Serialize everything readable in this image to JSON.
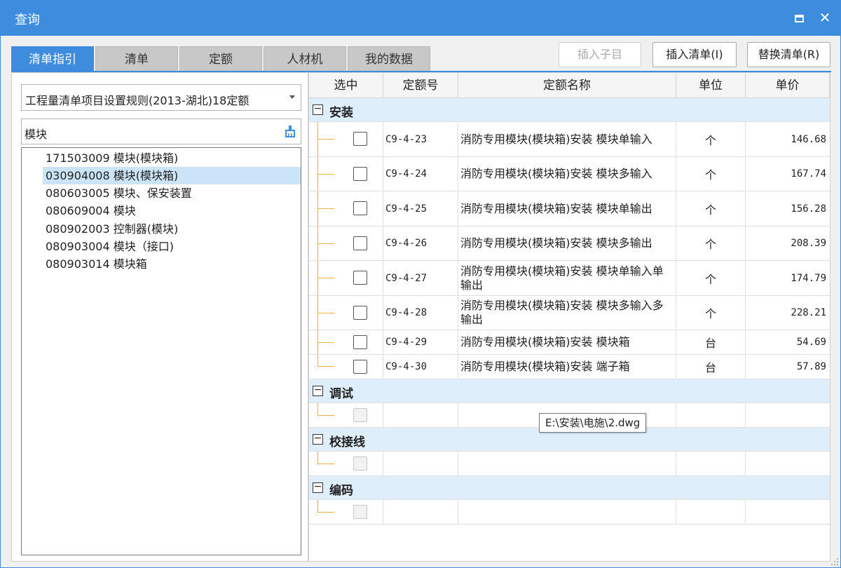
{
  "window": {
    "title": "查询"
  },
  "tabs": [
    {
      "label": "清单指引"
    },
    {
      "label": "清单"
    },
    {
      "label": "定额"
    },
    {
      "label": "人材机"
    },
    {
      "label": "我的数据"
    }
  ],
  "toolbar": {
    "insert_child_label": "插入子目",
    "insert_list_label": "插入清单(I)",
    "replace_list_label": "替换清单(R)"
  },
  "left": {
    "rule_select_value": "工程量清单项目设置规则(2013-湖北)18定额",
    "search_value": "模块",
    "items": [
      {
        "text": "171503009  模块(模块箱)"
      },
      {
        "text": "030904008  模块(模块箱)"
      },
      {
        "text": "080603005  模块、保安装置"
      },
      {
        "text": "080609004  模块"
      },
      {
        "text": "080902003  控制器(模块)"
      },
      {
        "text": "080903004  模块（接口)"
      },
      {
        "text": "080903014  模块箱"
      }
    ]
  },
  "grid": {
    "headers": {
      "select": "选中",
      "code": "定额号",
      "name": "定额名称",
      "unit": "单位",
      "price": "单价"
    },
    "groups": [
      {
        "name": "安装",
        "rows": [
          {
            "code": "C9-4-23",
            "name": "消防专用模块(模块箱)安装 模块单输入",
            "unit": "个",
            "price": "146.68"
          },
          {
            "code": "C9-4-24",
            "name": "消防专用模块(模块箱)安装 模块多输入",
            "unit": "个",
            "price": "167.74"
          },
          {
            "code": "C9-4-25",
            "name": "消防专用模块(模块箱)安装 模块单输出",
            "unit": "个",
            "price": "156.28"
          },
          {
            "code": "C9-4-26",
            "name": "消防专用模块(模块箱)安装 模块多输出",
            "unit": "个",
            "price": "208.39"
          },
          {
            "code": "C9-4-27",
            "name": "消防专用模块(模块箱)安装 模块单输入单输出",
            "unit": "个",
            "price": "174.79"
          },
          {
            "code": "C9-4-28",
            "name": "消防专用模块(模块箱)安装 模块多输入多输出",
            "unit": "个",
            "price": "228.21"
          },
          {
            "code": "C9-4-29",
            "name": "消防专用模块(模块箱)安装 模块箱",
            "unit": "台",
            "price": "54.69"
          },
          {
            "code": "C9-4-30",
            "name": "消防专用模块(模块箱)安装 端子箱",
            "unit": "台",
            "price": "57.89"
          }
        ]
      },
      {
        "name": "调试",
        "rows": []
      },
      {
        "name": "校接线",
        "rows": []
      },
      {
        "name": "编码",
        "rows": []
      }
    ]
  },
  "tooltip": {
    "text": "E:\\安装\\电施\\2.dwg"
  },
  "colors": {
    "accent": "#3d8cde",
    "group_bg": "#dfeefb",
    "selected_bg": "#cce4f7"
  }
}
